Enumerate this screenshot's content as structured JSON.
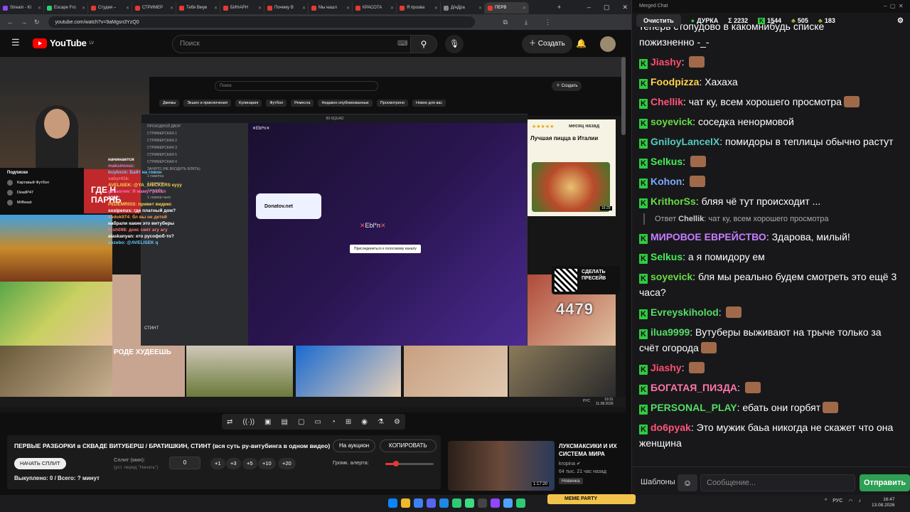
{
  "browser": {
    "tabs": [
      {
        "label": "Stream - Ki",
        "color": "#9146ff"
      },
      {
        "label": "Escape Fro",
        "color": "#2ecc71"
      },
      {
        "label": "Студия –",
        "color": "#e53935"
      },
      {
        "label": "СТРИМЕР",
        "color": "#e53935"
      },
      {
        "label": "Тебя Вмув",
        "color": "#e53935"
      },
      {
        "label": "БИНАРН",
        "color": "#e53935"
      },
      {
        "label": "Почему В",
        "color": "#e53935"
      },
      {
        "label": "Мы нашл",
        "color": "#e53935"
      },
      {
        "label": "КРАСОТА",
        "color": "#e53935"
      },
      {
        "label": "Я прозва",
        "color": "#e53935"
      },
      {
        "label": "Д/нДра",
        "color": "#888888"
      },
      {
        "label": "ПЕРВ",
        "color": "#e53935",
        "active": true
      }
    ],
    "url": "youtube.com/watch?v=9aMgsn3YzQ0"
  },
  "youtube": {
    "logo_text": "YouTube",
    "logo_suffix": "LV",
    "search_placeholder": "Поиск",
    "create_label": "Создать"
  },
  "stream_overlay": {
    "inner_search": "Поиск",
    "inner_create": "Создать",
    "inner_tabs": [
      "Джемы",
      "Экшен и приключения",
      "Кулинария",
      "Футбол",
      "Ремесла",
      "Недавно опубликованные",
      "Просмотрено",
      "Новое для вас"
    ],
    "subscriptions_label": "Подписки",
    "subs": [
      "Картавый Футбол",
      "DeadP47",
      "MrBeast"
    ],
    "discord_server": "89-SQUAD",
    "discord_channels": [
      "ПРОХОДНОЙ ДВОР",
      "СТРИМЕРСКАЯ 1",
      "СТРИМЕРСКАЯ 2",
      "СТРИМЕРСКАЯ 3",
      "СТРИМЕРСКАЯ 5",
      "СТРИМЕРСКАЯ 4",
      "ЗАНЯТО (НЕ ВХОДИТЬ БЛЯТЬ)",
      "1 памятка",
      "1 правила",
      "1 жалоба",
      "1 сервер-чьюс"
    ],
    "discord_user": "СТИНТ",
    "discord_channel_title": "Ebl*n",
    "discord_join": "Присоединиться к голосовому каналу",
    "donatov": "Donatov.net",
    "overlay_chat": [
      "начинается",
      "maksimooz:",
      "buybxck: Байт на говон",
      "sabyr41k:",
      "AVELISEK: @YA_SNICKERS кууу",
      "gimasrew: Я мамут рахал",
      "1337:",
      "PEDEMRISS: привет видикс",
      "sosipenus: где платный дом?",
      "xodok974: бл вы не детей",
      "набрали какие это витуберы",
      "Rish098: докс свят агу агу",
      "aiaskanyan: кто русофоб-то?",
      "aozebo: @AVELISEK q"
    ],
    "promo_rating": "месяц назад",
    "promo_title": "Лучшая пицца в Италии",
    "promo_duration": "16:29",
    "qr_text": "СДЕЛАТЬ ПРЕСЕЙВ",
    "counter": "4479",
    "thumb_text_1": "ГДЕ Н ПАРНЬ",
    "thumb_text_2": "РОДЕ ХУДЕЕШЬ",
    "inner_time": "19:31",
    "inner_date": "11.08.2026",
    "inner_lang": "РУС"
  },
  "player_tools": [
    "⇄",
    "((·))",
    "▣",
    "▤",
    "▢",
    "▭",
    "◔",
    "⊞",
    "◉",
    "⚗",
    "⚙"
  ],
  "video": {
    "title": "ПЕРВЫЕ РАЗБОРКИ в СКВАДЕ ВИТУБЕРШ / БРАТИШКИН, СТИНТ (вся суть ру-витубинга в одном видео)",
    "auction_label": "На аукцион",
    "copy_label": "КОПИРОВАТЬ",
    "start_split_label": "НАЧАТЬ СПЛИТ",
    "split_label": "Сплит (мин):",
    "split_hint": "(уст. перед \"Начать\")",
    "split_value": "0",
    "steps": [
      "+1",
      "+3",
      "+5",
      "+10",
      "+20"
    ],
    "alert_label": "Громк. алерта:",
    "alert_volume": 0.22,
    "paid_line": "Выкуплено: 0 / Всего: ? минут"
  },
  "recommended": {
    "title": "ЛУКСМАКСИКИ И ИХ СИСТЕМА МИРА",
    "channel": "kropina",
    "meta": "64 тыс. 21 час назад",
    "badge": "Новинка",
    "duration": "1:17:20"
  },
  "chat": {
    "window_title": "Merged Chat",
    "clear_label": "Очистить",
    "stats": [
      {
        "icon": "dot",
        "value": "ДУРКА"
      },
      {
        "icon": "sigma",
        "value": "Σ 2232"
      },
      {
        "icon": "kick",
        "value": "1544"
      },
      {
        "icon": "sprout",
        "value": "505"
      },
      {
        "icon": "bolt",
        "value": "183"
      }
    ],
    "top_partial": "теперь стопудово в какомнибудь списке",
    "top_partial_2": "пожизненно -_-",
    "messages": [
      {
        "user": "Jiashy",
        "color": "#ff4d6d",
        "text": "",
        "emote": true
      },
      {
        "user": "Foodpizza",
        "color": "#ffd24d",
        "text": "Хахаха"
      },
      {
        "user": "Chellik",
        "color": "#ff5577",
        "text": "чат ку, всем хорошего просмотра",
        "emote": true
      },
      {
        "user": "soyevick",
        "color": "#66dd44",
        "text": "соседка ненормовой"
      },
      {
        "user": "GniloyLanceIX",
        "color": "#55ccbb",
        "text": "помидоры в теплицы обычно растут"
      },
      {
        "user": "Selkus",
        "color": "#44ee55",
        "text": "",
        "emote": true
      },
      {
        "user": "Kohon",
        "color": "#7aa8ff",
        "text": "",
        "emote": true
      },
      {
        "user": "KrithorSs",
        "color": "#66dd44",
        "text": "бляя чё тут происходит ..."
      },
      {
        "user": "МИРОВОЕ ЕВРЕЙСТВО",
        "color": "#c77dff",
        "text": "Здарова, милый!"
      },
      {
        "user": "Selkus",
        "color": "#44ee55",
        "text": "а я помидору ем"
      },
      {
        "user": "soyevick",
        "color": "#66dd44",
        "text": "бля мы реально будем смотреть это ещё 3 часа?"
      },
      {
        "user": "Evreyskiholod",
        "color": "#55dd66",
        "text": "",
        "emote": true
      },
      {
        "user": "ilua9999",
        "color": "#55dd66",
        "text": "Вутуберы выживают на трыче только за счёт огорода",
        "emote": true
      },
      {
        "user": "Jiashy",
        "color": "#ff4d6d",
        "text": "",
        "emote": true
      },
      {
        "user": "БОГАТАЯ_ПИЗДА",
        "color": "#ff77aa",
        "text": "",
        "emote": true
      },
      {
        "user": "PERSONAL_PLAY",
        "color": "#55dd66",
        "text": "ебать они горбят",
        "emote": true
      },
      {
        "user": "do6pyak",
        "color": "#ff5577",
        "text": "Это мужик баьа никогда не скажет что она женщина"
      }
    ],
    "reply_prefix": "Ответ",
    "reply_user": "Chellik",
    "reply_text": "чат ку, всем хорошего просмотра",
    "templates_label": "Шаблоны",
    "input_placeholder": "Сообщение...",
    "send_label": "Отправить"
  },
  "taskbar": {
    "lang": "РУС",
    "time": "16:47",
    "date": "13.08.2026",
    "meme_party": "MEME PARTY"
  }
}
